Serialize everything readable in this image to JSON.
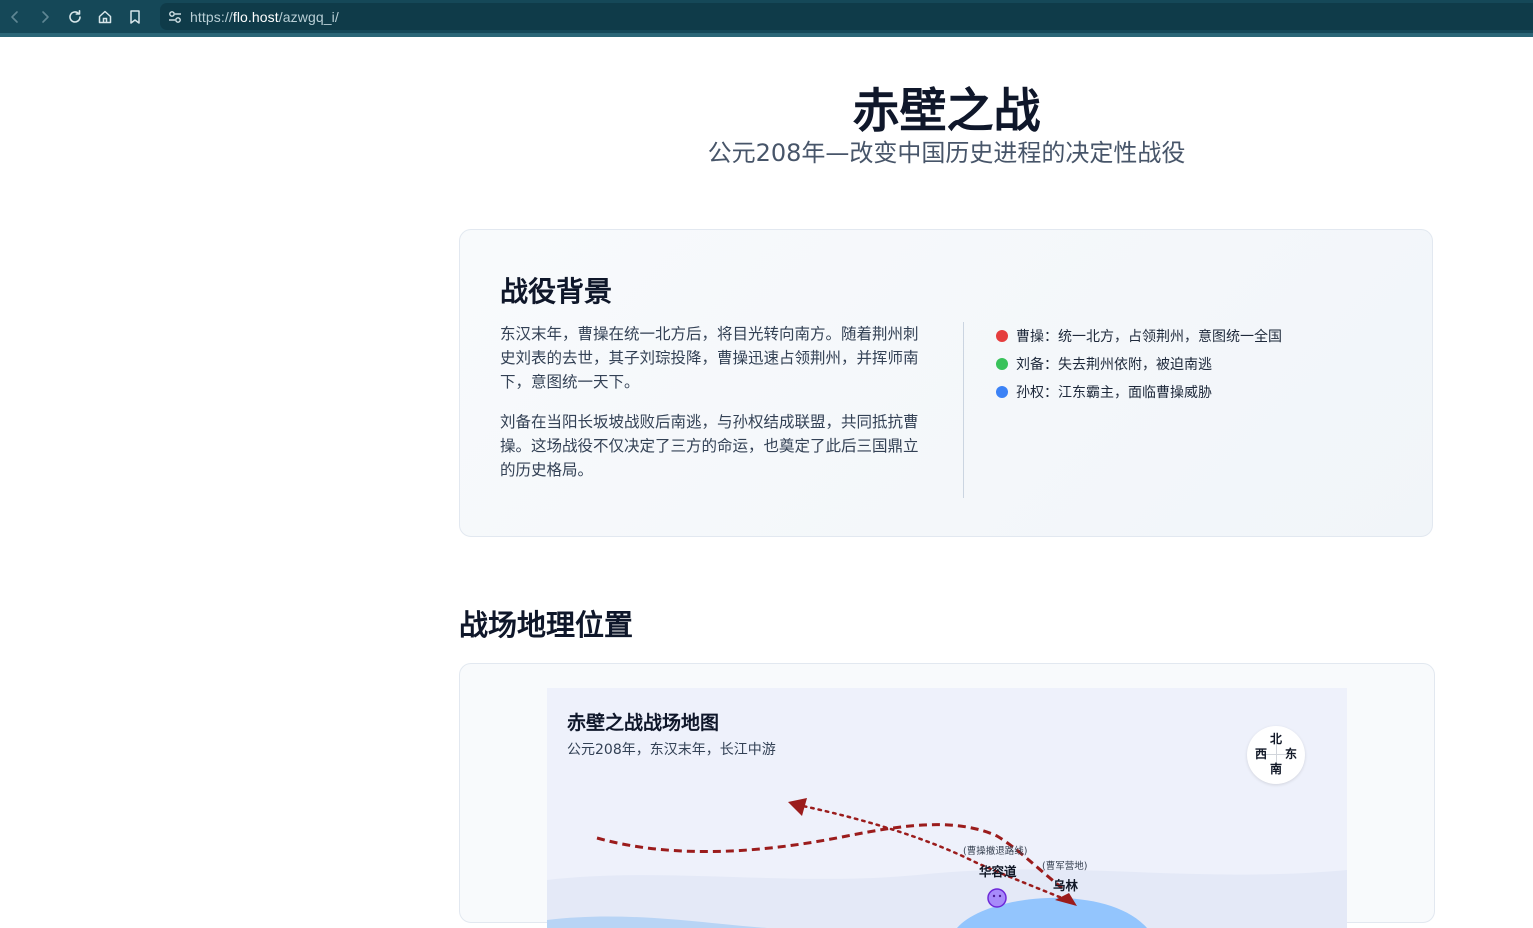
{
  "browser": {
    "url_scheme": "https://",
    "url_host": "flo.host",
    "url_path": "/azwgq_i/",
    "icons": [
      "back-icon",
      "forward-icon",
      "reload-icon",
      "home-icon",
      "bookmark-icon",
      "site-settings-icon"
    ]
  },
  "page": {
    "title": "赤壁之战",
    "subtitle": "公元208年—改变中国历史进程的决定性战役"
  },
  "background": {
    "heading": "战役背景",
    "paragraphs": [
      "东汉末年，曹操在统一北方后，将目光转向南方。随着荆州刺史刘表的去世，其子刘琮投降，曹操迅速占领荆州，并挥师南下，意图统一天下。",
      "刘备在当阳长坂坡战败后南逃，与孙权结成联盟，共同抵抗曹操。这场战役不仅决定了三方的命运，也奠定了此后三国鼎立的历史格局。"
    ],
    "factions": [
      {
        "text": "曹操：统一北方，占领荆州，意图统一全国",
        "color": "#e53e3e"
      },
      {
        "text": "刘备：失去荆州依附，被迫南逃",
        "color": "#38c25a"
      },
      {
        "text": "孙权：江东霸主，面临曹操威胁",
        "color": "#3b82f6"
      }
    ]
  },
  "geography": {
    "heading": "战场地理位置",
    "map_title": "赤壁之战战场地图",
    "map_subtitle": "公元208年，东汉末年，长江中游",
    "compass": {
      "north": "北",
      "south": "南",
      "west": "西",
      "east": "东"
    },
    "places": [
      {
        "name": "华容道",
        "note": "(曹操撤退路线)"
      },
      {
        "name": "乌林",
        "note": "(曹军营地)"
      }
    ],
    "colors": {
      "route": "#9b1c1c",
      "river": "#93c5fd",
      "map_bg": "#eef1fb"
    }
  }
}
